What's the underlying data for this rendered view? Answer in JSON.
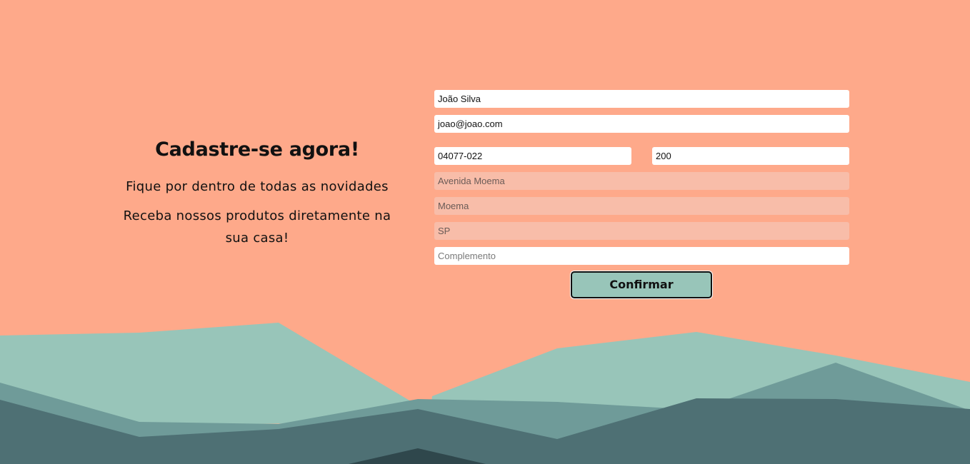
{
  "intro": {
    "title": "Cadastre-se agora!",
    "line1": "Fique por dentro de todas as novidades",
    "line2": "Receba nossos produtos diretamente na sua casa!"
  },
  "form": {
    "name": {
      "value": "João Silva"
    },
    "email": {
      "value": "joao@joao.com"
    },
    "cep": {
      "value": "04077-022"
    },
    "number": {
      "value": "200"
    },
    "street": {
      "value": "Avenida Moema"
    },
    "district": {
      "value": "Moema"
    },
    "state": {
      "value": "SP"
    },
    "complement": {
      "placeholder": "Complemento"
    },
    "confirm_label": "Confirmar"
  },
  "colors": {
    "background": "#fea98a",
    "hill_light": "#98c5b9",
    "hill_mid": "#6f9b99",
    "hill_dark": "#4e7074",
    "hill_darkest": "#2f474c",
    "button": "#98c5b9",
    "readonly_field": "#f8bda9"
  }
}
